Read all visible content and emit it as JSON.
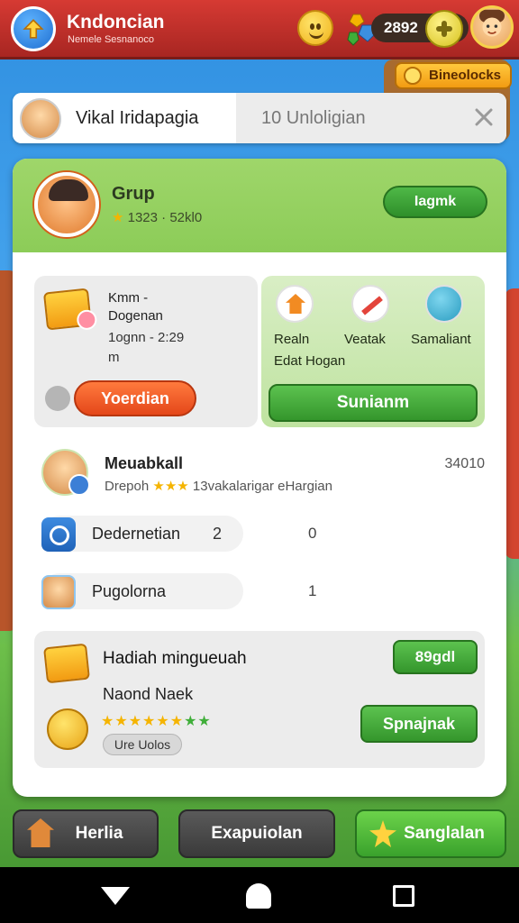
{
  "header": {
    "title": "Kndoncian",
    "subtitle": "Nemele Sesnanoco",
    "counter": "2892",
    "up_icon": "arrow-up-icon",
    "smiley_icon": "smiley-icon",
    "gem_icon": "gems-icon",
    "coin_icon": "plus-coin-icon"
  },
  "section_badge": {
    "label": "Bineolocks"
  },
  "tabs": {
    "active_label": "Vikal Iridapagia",
    "inactive_label": "10 Unloligian"
  },
  "group": {
    "title": "Grup",
    "meta": "1323 · 52kl0",
    "button_label": "Iagmk"
  },
  "left_panel": {
    "line1": "Kmm -",
    "line2": "Dogenan",
    "line3": "1ognn - 2:29",
    "line4": "m",
    "button_label": "Yoerdian"
  },
  "right_panel": {
    "labels": [
      "Realn",
      "Veatak",
      "Samaliant"
    ],
    "sub": "Edat Hogan",
    "button_label": "Sunianm"
  },
  "list": {
    "top": {
      "name": "Meuabkall",
      "sub_prefix": "Drepoh",
      "sub_stars": "★★★",
      "sub_suffix": "13vakalarigar eHargian",
      "value": "34010"
    },
    "rows": [
      {
        "label": "Dedernetian",
        "num": "2",
        "value": "0"
      },
      {
        "label": "Pugolorna",
        "num": "",
        "value": "1"
      }
    ]
  },
  "reward": {
    "title": "Hadiah mingueuah",
    "sub": "Naond Naek",
    "stars_gold": "★★★★★★",
    "stars_green": "★★",
    "tag": "Ure Uolos",
    "badge": "89gdl",
    "button_label": "Spnajnak"
  },
  "bottom_bar": {
    "home_label": "Herlia",
    "mid_label": "Exapuiolan",
    "go_label": "Sanglalan"
  },
  "colors": {
    "header_red": "#d63a33",
    "accent_green": "#4fb847",
    "accent_orange": "#ff7a3d",
    "accent_gold": "#f5b400"
  }
}
